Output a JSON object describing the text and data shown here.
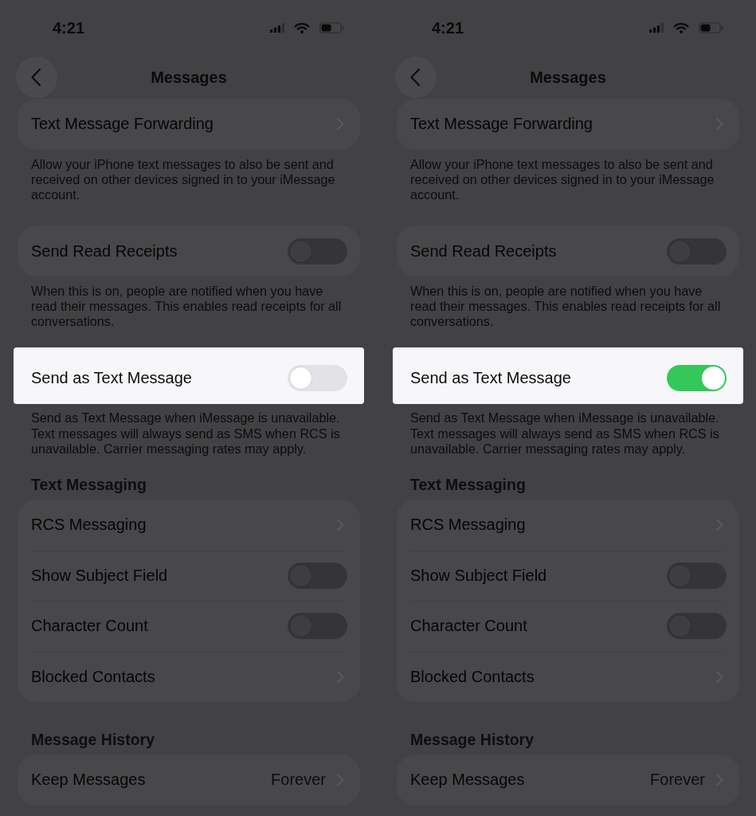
{
  "panels": [
    {
      "status_bar": {
        "time": "4:21"
      },
      "nav": {
        "title": "Messages"
      },
      "groups": [
        {
          "rows": [
            {
              "kind": "link",
              "label": "Text Message Forwarding",
              "highlighted": false
            }
          ],
          "footer": "Allow your iPhone text messages to also be sent and received on other devices signed in to your iMessage account."
        },
        {
          "rows": [
            {
              "kind": "toggle",
              "label": "Send Read Receipts",
              "on": false,
              "highlighted": false
            }
          ],
          "footer": "When this is on, people are notified when you have read their messages. This enables read receipts for all conversations."
        },
        {
          "rows": [
            {
              "kind": "toggle",
              "label": "Send as Text Message",
              "on": false,
              "highlighted": true
            }
          ],
          "footer": "Send as Text Message when iMessage is unavailable. Text messages will always send as SMS when RCS is unavailable. Carrier messaging rates may apply."
        },
        {
          "header": "Text Messaging",
          "rows": [
            {
              "kind": "link",
              "label": "RCS Messaging",
              "highlighted": false
            },
            {
              "kind": "toggle",
              "label": "Show Subject Field",
              "on": false,
              "highlighted": false
            },
            {
              "kind": "toggle",
              "label": "Character Count",
              "on": false,
              "highlighted": false
            },
            {
              "kind": "link",
              "label": "Blocked Contacts",
              "highlighted": false
            }
          ]
        },
        {
          "header": "Message History",
          "rows": [
            {
              "kind": "link",
              "label": "Keep Messages",
              "value": "Forever",
              "highlighted": false
            }
          ]
        }
      ]
    },
    {
      "status_bar": {
        "time": "4:21"
      },
      "nav": {
        "title": "Messages"
      },
      "groups": [
        {
          "rows": [
            {
              "kind": "link",
              "label": "Text Message Forwarding",
              "highlighted": false
            }
          ],
          "footer": "Allow your iPhone text messages to also be sent and received on other devices signed in to your iMessage account."
        },
        {
          "rows": [
            {
              "kind": "toggle",
              "label": "Send Read Receipts",
              "on": false,
              "highlighted": false
            }
          ],
          "footer": "When this is on, people are notified when you have read their messages. This enables read receipts for all conversations."
        },
        {
          "rows": [
            {
              "kind": "toggle",
              "label": "Send as Text Message",
              "on": true,
              "highlighted": true
            }
          ],
          "footer": "Send as Text Message when iMessage is unavailable. Text messages will always send as SMS when RCS is unavailable. Carrier messaging rates may apply."
        },
        {
          "header": "Text Messaging",
          "rows": [
            {
              "kind": "link",
              "label": "RCS Messaging",
              "highlighted": false
            },
            {
              "kind": "toggle",
              "label": "Show Subject Field",
              "on": false,
              "highlighted": false
            },
            {
              "kind": "toggle",
              "label": "Character Count",
              "on": false,
              "highlighted": false
            },
            {
              "kind": "link",
              "label": "Blocked Contacts",
              "highlighted": false
            }
          ]
        },
        {
          "header": "Message History",
          "rows": [
            {
              "kind": "link",
              "label": "Keep Messages",
              "value": "Forever",
              "highlighted": false
            }
          ]
        }
      ]
    }
  ]
}
